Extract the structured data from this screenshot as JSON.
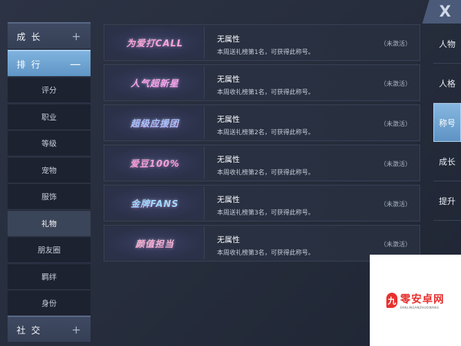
{
  "sidebar": {
    "groups": [
      {
        "label": "成 长",
        "sign": "+"
      },
      {
        "label": "排 行",
        "sign": "—"
      }
    ],
    "sub_items": [
      {
        "label": "评分"
      },
      {
        "label": "职业"
      },
      {
        "label": "等级"
      },
      {
        "label": "宠物"
      },
      {
        "label": "服饰"
      },
      {
        "label": "礼物"
      },
      {
        "label": "朋友圈"
      },
      {
        "label": "羁绊"
      },
      {
        "label": "身份"
      }
    ],
    "bottom_group": {
      "label": "社 交",
      "sign": "+"
    }
  },
  "titles": [
    {
      "badge": "为爱打CALL",
      "badge_color": "#f7a6d8",
      "title": "无属性",
      "desc": "本周送礼榜第1名，可获得此称号。",
      "status": "（未激活）"
    },
    {
      "badge": "人气超新星",
      "badge_color": "#f3a5e8",
      "title": "无属性",
      "desc": "本周收礼榜第1名，可获得此称号。",
      "status": "（未激活）"
    },
    {
      "badge": "超级应援团",
      "badge_color": "#a8c4ff",
      "title": "无属性",
      "desc": "本周送礼榜第2名，可获得此称号。",
      "status": "（未激活）"
    },
    {
      "badge": "爱豆100%",
      "badge_color": "#f4a0d6",
      "title": "无属性",
      "desc": "本周收礼榜第2名，可获得此称号。",
      "status": "（未激活）"
    },
    {
      "badge": "金牌FANS",
      "badge_color": "#9fd8ff",
      "title": "无属性",
      "desc": "本周送礼榜第3名，可获得此称号。",
      "status": "（未激活）"
    },
    {
      "badge": "颜值担当",
      "badge_color": "#f6b3d3",
      "title": "无属性",
      "desc": "本周收礼榜第3名，可获得此称号。",
      "status": "（未激活）"
    }
  ],
  "tabs": [
    {
      "label": "人物"
    },
    {
      "label": "人格"
    },
    {
      "label": "称号"
    },
    {
      "label": "成长"
    },
    {
      "label": "提升"
    }
  ],
  "close_label": "X",
  "watermark": {
    "logo": "九",
    "cn": "零安卓网",
    "en": "0ANLINGANZHUOWANG"
  }
}
